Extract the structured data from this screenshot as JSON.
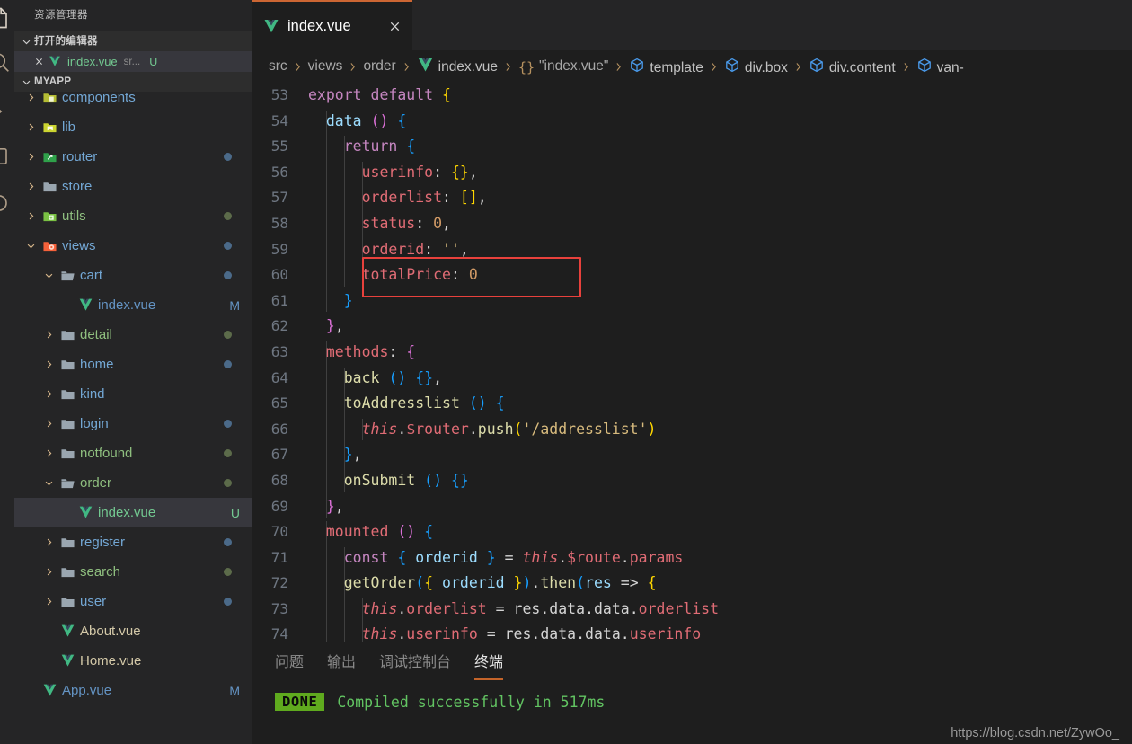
{
  "activity_bar": {
    "icons": [
      "files-explorer-icon",
      "search-icon",
      "source-control-icon",
      "run-debug-icon",
      "extensions-icon"
    ]
  },
  "sidebar": {
    "title": "资源管理器",
    "open_editors": {
      "section_label": "打开的编辑器",
      "items": [
        {
          "name": "index.vue",
          "description": "sr...",
          "badge": "U",
          "icon": "vue-file-icon",
          "close": "close-icon"
        }
      ]
    },
    "workspace": {
      "section_label": "MYAPP",
      "tree": [
        {
          "label": "components",
          "type": "folder",
          "icon": "folder-components-icon",
          "indent": 1,
          "expanded": false,
          "dot": "",
          "badge": "",
          "clipped": true
        },
        {
          "label": "lib",
          "type": "folder",
          "icon": "folder-lib-icon",
          "indent": 1,
          "expanded": false,
          "dot": "",
          "badge": ""
        },
        {
          "label": "router",
          "type": "folder",
          "icon": "folder-router-icon",
          "indent": 1,
          "expanded": false,
          "dot": "#4b6a89",
          "badge": ""
        },
        {
          "label": "store",
          "type": "folder",
          "icon": "folder-icon",
          "indent": 1,
          "expanded": false,
          "dot": "",
          "badge": ""
        },
        {
          "label": "utils",
          "type": "folder",
          "icon": "folder-utils-icon",
          "indent": 1,
          "expanded": false,
          "dot": "#5c6b4a",
          "badge": ""
        },
        {
          "label": "views",
          "type": "folder",
          "icon": "folder-views-icon",
          "indent": 1,
          "expanded": true,
          "dot": "#4b6a89",
          "badge": ""
        },
        {
          "label": "cart",
          "type": "folder",
          "icon": "folder-open-icon",
          "indent": 2,
          "expanded": true,
          "dot": "#4b6a89",
          "badge": ""
        },
        {
          "label": "index.vue",
          "type": "file",
          "icon": "vue-file-icon",
          "indent": 3,
          "expanded": null,
          "dot": "",
          "badge": "M"
        },
        {
          "label": "detail",
          "type": "folder",
          "icon": "folder-icon",
          "indent": 2,
          "expanded": false,
          "dot": "#5c6b4a",
          "badge": ""
        },
        {
          "label": "home",
          "type": "folder",
          "icon": "folder-icon",
          "indent": 2,
          "expanded": false,
          "dot": "#4b6a89",
          "badge": ""
        },
        {
          "label": "kind",
          "type": "folder",
          "icon": "folder-icon",
          "indent": 2,
          "expanded": false,
          "dot": "",
          "badge": ""
        },
        {
          "label": "login",
          "type": "folder",
          "icon": "folder-icon",
          "indent": 2,
          "expanded": false,
          "dot": "#4b6a89",
          "badge": ""
        },
        {
          "label": "notfound",
          "type": "folder",
          "icon": "folder-icon",
          "indent": 2,
          "expanded": false,
          "dot": "#5c6b4a",
          "badge": ""
        },
        {
          "label": "order",
          "type": "folder",
          "icon": "folder-open-icon",
          "indent": 2,
          "expanded": true,
          "dot": "#5c6b4a",
          "badge": ""
        },
        {
          "label": "index.vue",
          "type": "file",
          "icon": "vue-file-icon",
          "indent": 3,
          "expanded": null,
          "dot": "",
          "badge": "U",
          "selected": true
        },
        {
          "label": "register",
          "type": "folder",
          "icon": "folder-icon",
          "indent": 2,
          "expanded": false,
          "dot": "#4b6a89",
          "badge": ""
        },
        {
          "label": "search",
          "type": "folder",
          "icon": "folder-icon",
          "indent": 2,
          "expanded": false,
          "dot": "#5c6b4a",
          "badge": ""
        },
        {
          "label": "user",
          "type": "folder",
          "icon": "folder-icon",
          "indent": 2,
          "expanded": false,
          "dot": "#4b6a89",
          "badge": ""
        },
        {
          "label": "About.vue",
          "type": "file",
          "icon": "vue-file-icon",
          "indent": 2,
          "expanded": null,
          "dot": "",
          "badge": ""
        },
        {
          "label": "Home.vue",
          "type": "file",
          "icon": "vue-file-icon",
          "indent": 2,
          "expanded": null,
          "dot": "",
          "badge": ""
        },
        {
          "label": "App.vue",
          "type": "file",
          "icon": "vue-file-icon",
          "indent": 1,
          "expanded": null,
          "dot": "",
          "badge": "M"
        }
      ]
    }
  },
  "editor": {
    "tabs": [
      {
        "label": "index.vue",
        "icon": "vue-file-icon",
        "close": "close-icon",
        "active": true
      }
    ],
    "breadcrumb": [
      {
        "label": "src",
        "icon": ""
      },
      {
        "label": "views",
        "icon": ""
      },
      {
        "label": "order",
        "icon": ""
      },
      {
        "label": "index.vue",
        "icon": "vue-file-icon"
      },
      {
        "label": "\"index.vue\"",
        "icon": "braces-icon"
      },
      {
        "label": "template",
        "icon": "symbol-cube-icon"
      },
      {
        "label": "div.box",
        "icon": "symbol-cube-icon"
      },
      {
        "label": "div.content",
        "icon": "symbol-cube-icon"
      },
      {
        "label": "van-",
        "icon": "symbol-cube-icon"
      }
    ],
    "first_line_number": 53,
    "lines": [
      {
        "n": 53,
        "text": "export default {"
      },
      {
        "n": 54,
        "text": "  data () {"
      },
      {
        "n": 55,
        "text": "    return {"
      },
      {
        "n": 56,
        "text": "      userinfo: {},"
      },
      {
        "n": 57,
        "text": "      orderlist: [],"
      },
      {
        "n": 58,
        "text": "      status: 0,"
      },
      {
        "n": 59,
        "text": "      orderid: '',"
      },
      {
        "n": 60,
        "text": "      totalPrice: 0"
      },
      {
        "n": 61,
        "text": "    }"
      },
      {
        "n": 62,
        "text": "  },"
      },
      {
        "n": 63,
        "text": "  methods: {"
      },
      {
        "n": 64,
        "text": "    back () {},"
      },
      {
        "n": 65,
        "text": "    toAddresslist () {"
      },
      {
        "n": 66,
        "text": "      this.$router.push('/addresslist')"
      },
      {
        "n": 67,
        "text": "    },"
      },
      {
        "n": 68,
        "text": "    onSubmit () {}"
      },
      {
        "n": 69,
        "text": "  },"
      },
      {
        "n": 70,
        "text": "  mounted () {"
      },
      {
        "n": 71,
        "text": "    const { orderid } = this.$route.params"
      },
      {
        "n": 72,
        "text": "    getOrder({ orderid }).then(res => {"
      },
      {
        "n": 73,
        "text": "      this.orderlist = res.data.data.orderlist"
      },
      {
        "n": 74,
        "text": "      this.userinfo = res.data.data.userinfo"
      }
    ],
    "annotation": {
      "target_line": 60,
      "color": "#e8413c"
    }
  },
  "panel": {
    "tabs": [
      {
        "label": "问题",
        "active": false
      },
      {
        "label": "输出",
        "active": false
      },
      {
        "label": "调试控制台",
        "active": false
      },
      {
        "label": "终端",
        "active": true
      }
    ],
    "terminal": {
      "status_badge": "DONE",
      "message": "Compiled successfully in 517ms",
      "badge_color": "#5faa1e",
      "message_color": "#62c462"
    }
  },
  "watermark": "https://blog.csdn.net/ZywOo_"
}
